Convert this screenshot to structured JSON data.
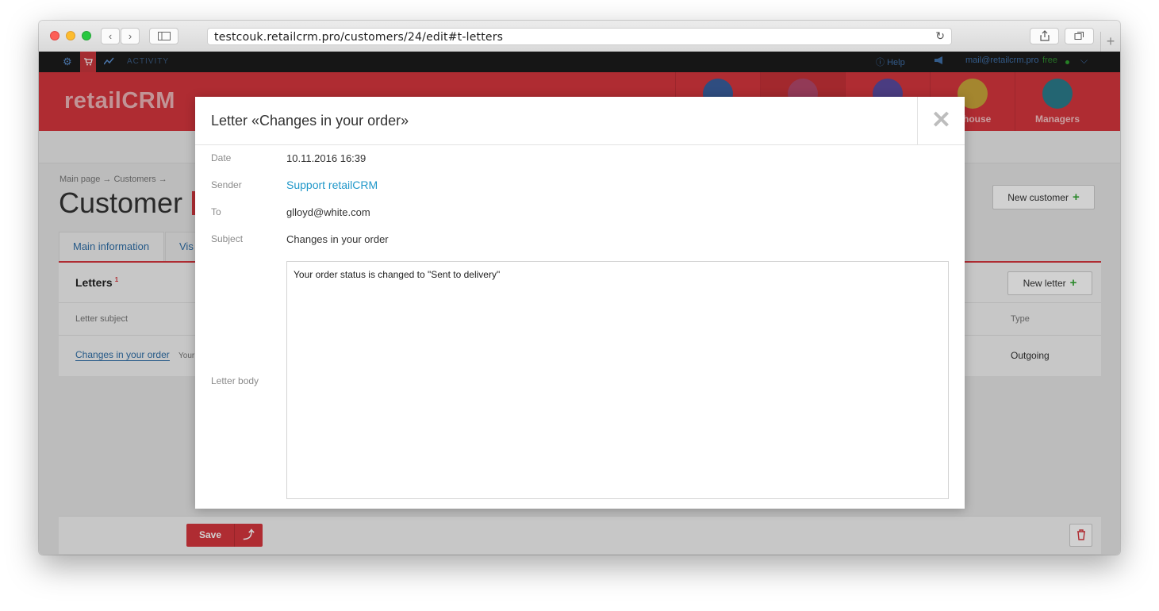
{
  "browser": {
    "url": "testcouk.retailcrm.pro/customers/24/edit#t-letters",
    "back_glyph": "‹",
    "forward_glyph": "›",
    "reload_glyph": "↻",
    "newtab_glyph": "+"
  },
  "topbar": {
    "activity": "ACTIVITY",
    "help": "Help",
    "email": "mail@retailcrm.pro",
    "plan": "free"
  },
  "header": {
    "logo": "retailCRM",
    "nav": [
      {
        "label": "",
        "icon": "orders-icon"
      },
      {
        "label": "",
        "icon": "customers-icon"
      },
      {
        "label": "",
        "icon": "tasks-icon"
      },
      {
        "label": "rehouse",
        "icon": "warehouse-icon"
      },
      {
        "label": "Managers",
        "icon": "managers-icon"
      }
    ]
  },
  "page": {
    "breadcrumb": "Main page → Customers →",
    "title": "Customer",
    "new_customer_label": "New customer",
    "tabs": [
      {
        "label": "Main information"
      },
      {
        "label": "Vis"
      }
    ],
    "letters_title": "Letters",
    "letters_count": "1",
    "new_letter_label": "New letter",
    "columns": {
      "subject": "Letter subject",
      "type": "Type"
    },
    "rows": [
      {
        "subject": "Changes in your order",
        "preview": "Your",
        "type": "Outgoing"
      }
    ],
    "save_label": "Save"
  },
  "modal": {
    "title": "Letter «Changes in your order»",
    "close_glyph": "✕",
    "fields": {
      "date_label": "Date",
      "date_value": "10.11.2016 16:39",
      "sender_label": "Sender",
      "sender_value": "Support retailCRM",
      "to_label": "To",
      "to_value": "glloyd@white.com",
      "subject_label": "Subject",
      "subject_value": "Changes in your order",
      "body_label": "Letter body",
      "body_value": "Your order status is changed to \"Sent to delivery\""
    }
  },
  "colors": {
    "brand_red": "#d6363d",
    "link_blue": "#1f97c9",
    "add_green": "#35a835"
  }
}
